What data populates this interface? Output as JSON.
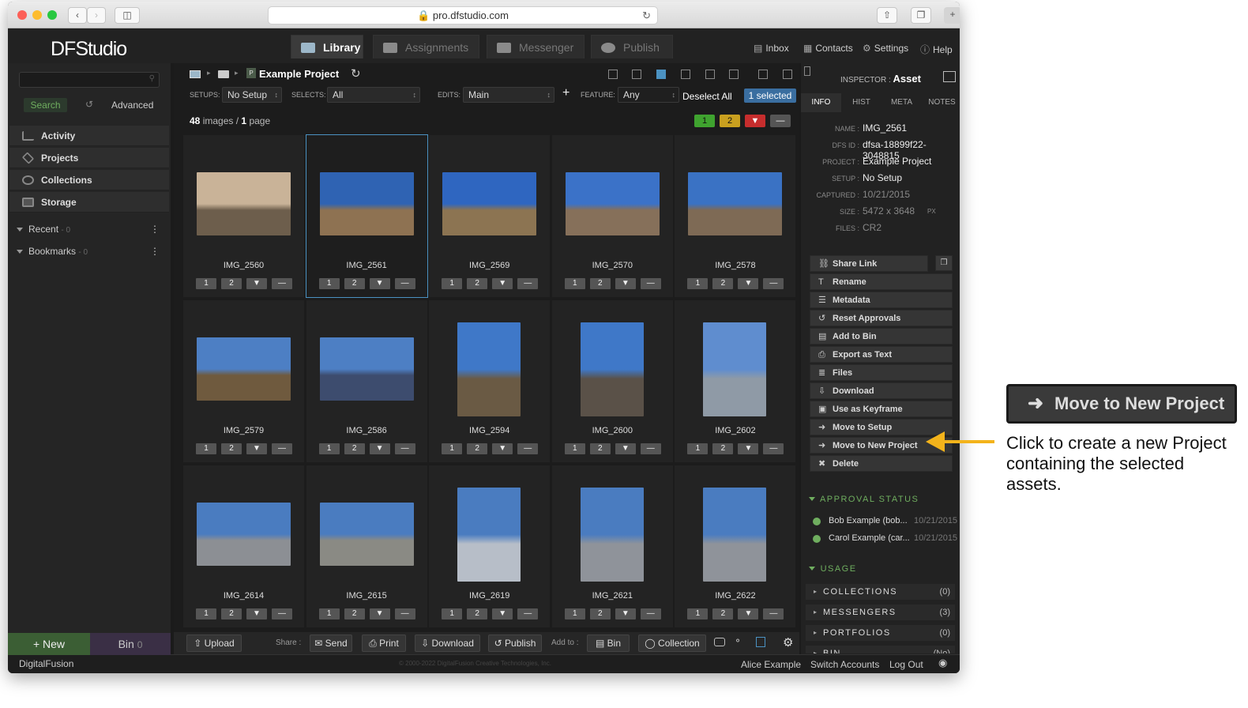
{
  "browser": {
    "url": "pro.dfstudio.com"
  },
  "app": {
    "logo": "DFStudio",
    "tabs": [
      {
        "label": "Library",
        "active": true
      },
      {
        "label": "Assignments"
      },
      {
        "label": "Messenger"
      },
      {
        "label": "Publish"
      }
    ],
    "toplinks": [
      "Inbox",
      "Contacts",
      "Settings",
      "Help"
    ]
  },
  "sidebar": {
    "search_button": "Search",
    "advanced": "Advanced",
    "nav": [
      "Activity",
      "Projects",
      "Collections",
      "Storage"
    ],
    "collapsibles": [
      {
        "label": "Recent",
        "count": "- 0"
      },
      {
        "label": "Bookmarks",
        "count": "- 0"
      }
    ],
    "new_label": "+ New",
    "bin_label": "Bin",
    "bin_count": "0"
  },
  "center": {
    "project_title": "Example Project",
    "setups_label": "SETUPS:",
    "setups_value": "No Setup",
    "selects_label": "SELECTS:",
    "selects_value": "All",
    "edits_label": "EDITS:",
    "edits_value": "Main",
    "feature_label": "FEATURE:",
    "feature_value": "Any",
    "deselect": "Deselect All",
    "selected": "1 selected",
    "images_count": "48",
    "images_word": "images /",
    "pages_count": "1",
    "pages_word": "page",
    "badges": [
      {
        "label": "1",
        "color": "#3fa32f"
      },
      {
        "label": "2",
        "color": "#c9a01f"
      },
      {
        "label": "▼",
        "color": "#c62d2d"
      },
      {
        "label": "—",
        "color": "#555555"
      }
    ],
    "images": [
      {
        "name": "IMG_2560",
        "orient": "land",
        "sky": "#c9b398",
        "ground": "#6d5e4c"
      },
      {
        "name": "IMG_2561",
        "orient": "land",
        "sky": "#2f63b3",
        "ground": "#8e7252",
        "selected": true
      },
      {
        "name": "IMG_2569",
        "orient": "land",
        "sky": "#2f66c0",
        "ground": "#8c7452"
      },
      {
        "name": "IMG_2570",
        "orient": "land",
        "sky": "#3b72c8",
        "ground": "#86705a"
      },
      {
        "name": "IMG_2578",
        "orient": "land",
        "sky": "#3a72c4",
        "ground": "#7e6a55"
      },
      {
        "name": "IMG_2579",
        "orient": "land",
        "sky": "#4d7fc4",
        "ground": "#6f5a3e"
      },
      {
        "name": "IMG_2586",
        "orient": "land",
        "sky": "#4d7fc4",
        "ground": "#3d4c6e"
      },
      {
        "name": "IMG_2594",
        "orient": "port",
        "sky": "#3f78c8",
        "ground": "#6a5a44"
      },
      {
        "name": "IMG_2600",
        "orient": "port",
        "sky": "#3f78c8",
        "ground": "#5a5148"
      },
      {
        "name": "IMG_2602",
        "orient": "port",
        "sky": "#5f8dcf",
        "ground": "#8f9aa6"
      },
      {
        "name": "IMG_2614",
        "orient": "land",
        "sky": "#4a7cc0",
        "ground": "#8c8f94"
      },
      {
        "name": "IMG_2615",
        "orient": "land",
        "sky": "#4a7cc0",
        "ground": "#8a8a84"
      },
      {
        "name": "IMG_2619",
        "orient": "port",
        "sky": "#4a7cc0",
        "ground": "#b7bec8"
      },
      {
        "name": "IMG_2621",
        "orient": "port",
        "sky": "#4a7cc0",
        "ground": "#8f939a"
      },
      {
        "name": "IMG_2622",
        "orient": "port",
        "sky": "#4a7cc0",
        "ground": "#8f939a"
      }
    ],
    "rating_labels": [
      "1",
      "2",
      "▼",
      "—"
    ]
  },
  "bottombar": {
    "upload": "Upload",
    "share": "Share :",
    "send": "Send",
    "print": "Print",
    "download": "Download",
    "publish": "Publish",
    "addto": "Add to :",
    "bin": "Bin",
    "collection": "Collection"
  },
  "inspector": {
    "title_label": "INSPECTOR :",
    "title_value": "Asset",
    "tabs": [
      "INFO",
      "HIST",
      "META",
      "NOTES"
    ],
    "info": [
      {
        "k": "NAME :",
        "v": "IMG_2561"
      },
      {
        "k": "DFS ID :",
        "v": "dfsa-18899f22-3048815"
      },
      {
        "k": "PROJECT :",
        "v": "Example Project"
      },
      {
        "k": "SETUP :",
        "v": "No Setup"
      },
      {
        "k": "CAPTURED :",
        "v": "10/21/2015"
      },
      {
        "k": "SIZE :",
        "v": "5472 x 3648",
        "unit": "PX"
      },
      {
        "k": "FILES :",
        "v": "CR2"
      }
    ],
    "actions": [
      "Share Link",
      "Rename",
      "Metadata",
      "Reset Approvals",
      "Add to Bin",
      "Export as Text",
      "Files",
      "Download",
      "Use as Keyframe",
      "Move to Setup",
      "Move to New Project",
      "Delete"
    ],
    "approval_title": "APPROVAL STATUS",
    "approvals": [
      {
        "name": "Bob Example (bob...",
        "date": "10/21/2015"
      },
      {
        "name": "Carol Example (car...",
        "date": "10/21/2015"
      }
    ],
    "usage_title": "USAGE",
    "usage": [
      {
        "label": "COLLECTIONS",
        "n": "(0)"
      },
      {
        "label": "MESSENGERS",
        "n": "(3)"
      },
      {
        "label": "PORTFOLIOS",
        "n": "(0)"
      },
      {
        "label": "BIN",
        "n": "(No)"
      }
    ]
  },
  "status": {
    "brand": "DigitalFusion",
    "copyright": "© 2000-2022 DigitalFusion Creative Technologies, Inc.",
    "user": "Alice Example",
    "switch": "Switch Accounts",
    "logout": "Log Out"
  },
  "callout": {
    "button": "Move to New Project",
    "text": "Click to create a new Project containing the selected assets.",
    "arrow_color": "#f3b31b"
  }
}
